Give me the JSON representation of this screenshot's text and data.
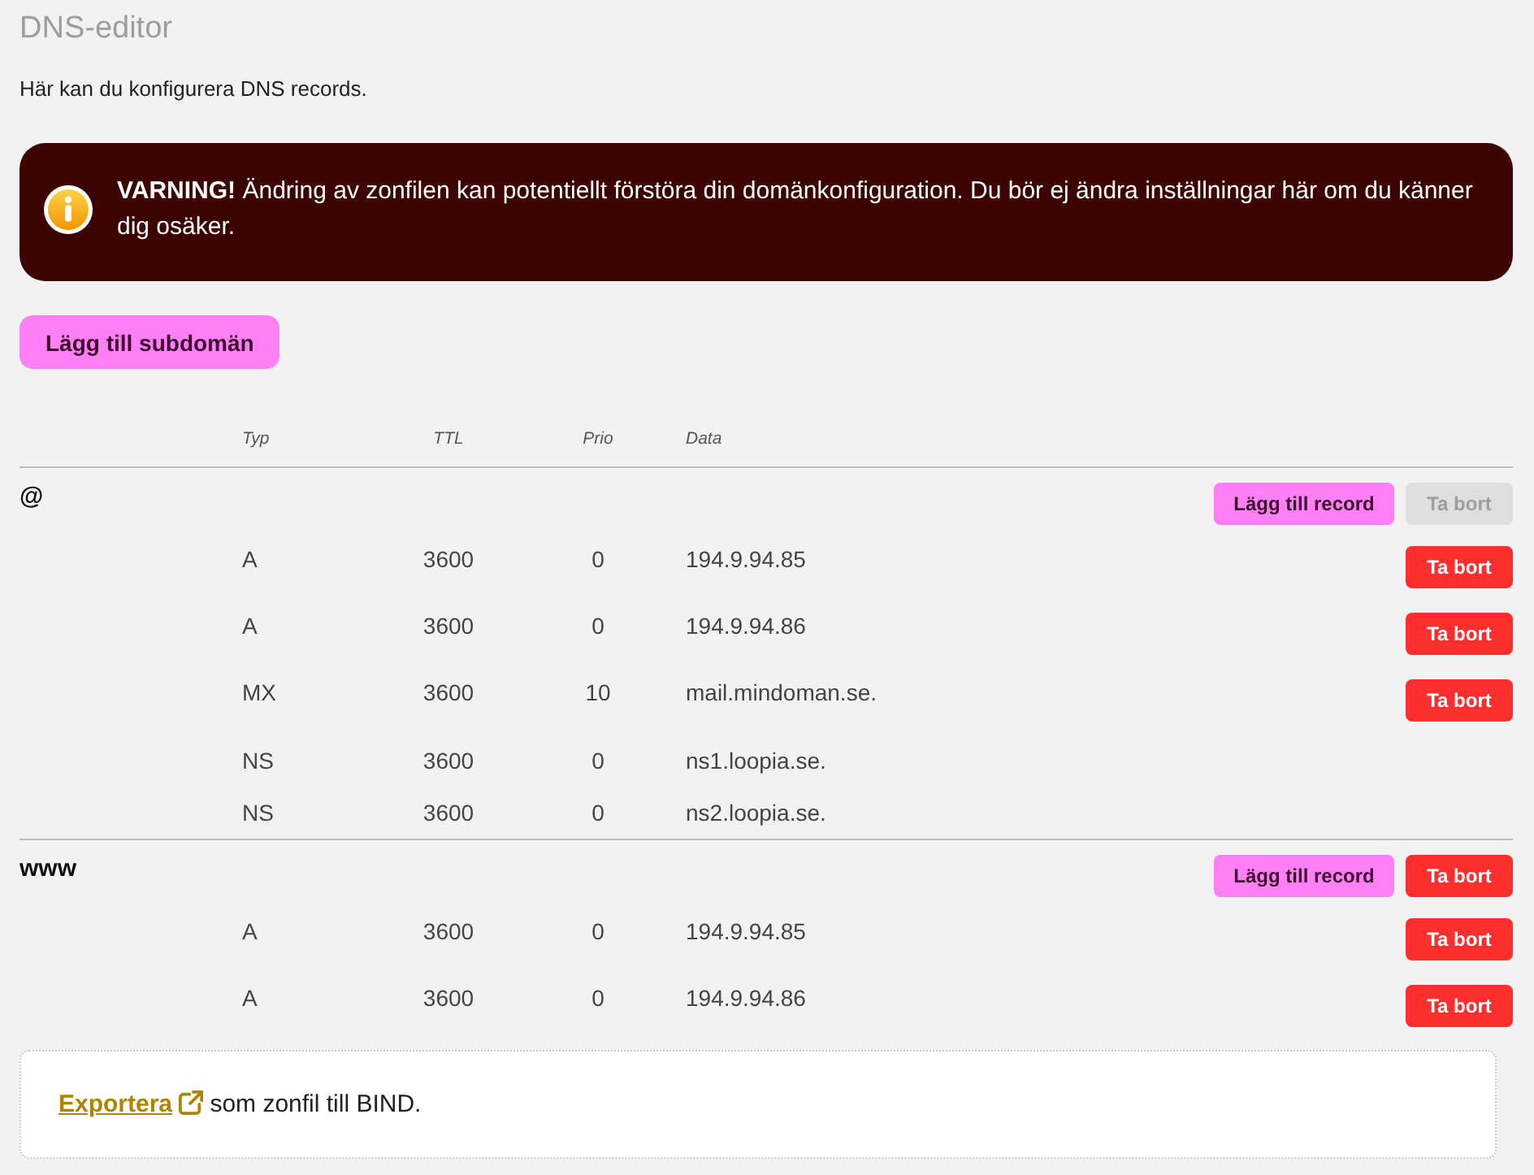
{
  "page": {
    "title": "DNS-editor",
    "intro": "Här kan du konfigurera DNS records."
  },
  "warning": {
    "text": "**VARNING!** Ändring av zonfilen kan potentiellt förstöra din domänkonfiguration. Du bör ej ändra inställningar här om du känner dig osäker."
  },
  "add_subdomain_button": "Lägg till subdomän",
  "table": {
    "columns": [
      "Typ",
      "TTL",
      "Prio",
      "Data"
    ],
    "groups": [
      {
        "name": "@",
        "add_button": "Lägg till record",
        "delete_button": {
          "label": "Ta bort",
          "disabled": true
        },
        "records": [
          {
            "type": "A",
            "ttl": "3600",
            "prio": "0",
            "data": "194.9.94.85",
            "delete_button": {
              "label": "Ta bort",
              "disabled": false
            }
          },
          {
            "type": "A",
            "ttl": "3600",
            "prio": "0",
            "data": "194.9.94.86",
            "delete_button": {
              "label": "Ta bort",
              "disabled": false
            }
          },
          {
            "type": "MX",
            "ttl": "3600",
            "prio": "10",
            "data": "mail.mindoman.se.",
            "delete_button": {
              "label": "Ta bort",
              "disabled": false
            }
          },
          {
            "type": "NS",
            "ttl": "3600",
            "prio": "0",
            "data": "ns1.loopia.se."
          },
          {
            "type": "NS",
            "ttl": "3600",
            "prio": "0",
            "data": "ns2.loopia.se."
          }
        ]
      },
      {
        "name": "www",
        "add_button": "Lägg till record",
        "delete_button": {
          "label": "Ta bort",
          "disabled": false
        },
        "records": [
          {
            "type": "A",
            "ttl": "3600",
            "prio": "0",
            "data": "194.9.94.85",
            "delete_button": {
              "label": "Ta bort",
              "disabled": false
            }
          },
          {
            "type": "A",
            "ttl": "3600",
            "prio": "0",
            "data": "194.9.94.86",
            "delete_button": {
              "label": "Ta bort",
              "disabled": false
            }
          }
        ]
      }
    ]
  },
  "export": {
    "link": "Exportera",
    "text": "som zonfil till BIND."
  }
}
